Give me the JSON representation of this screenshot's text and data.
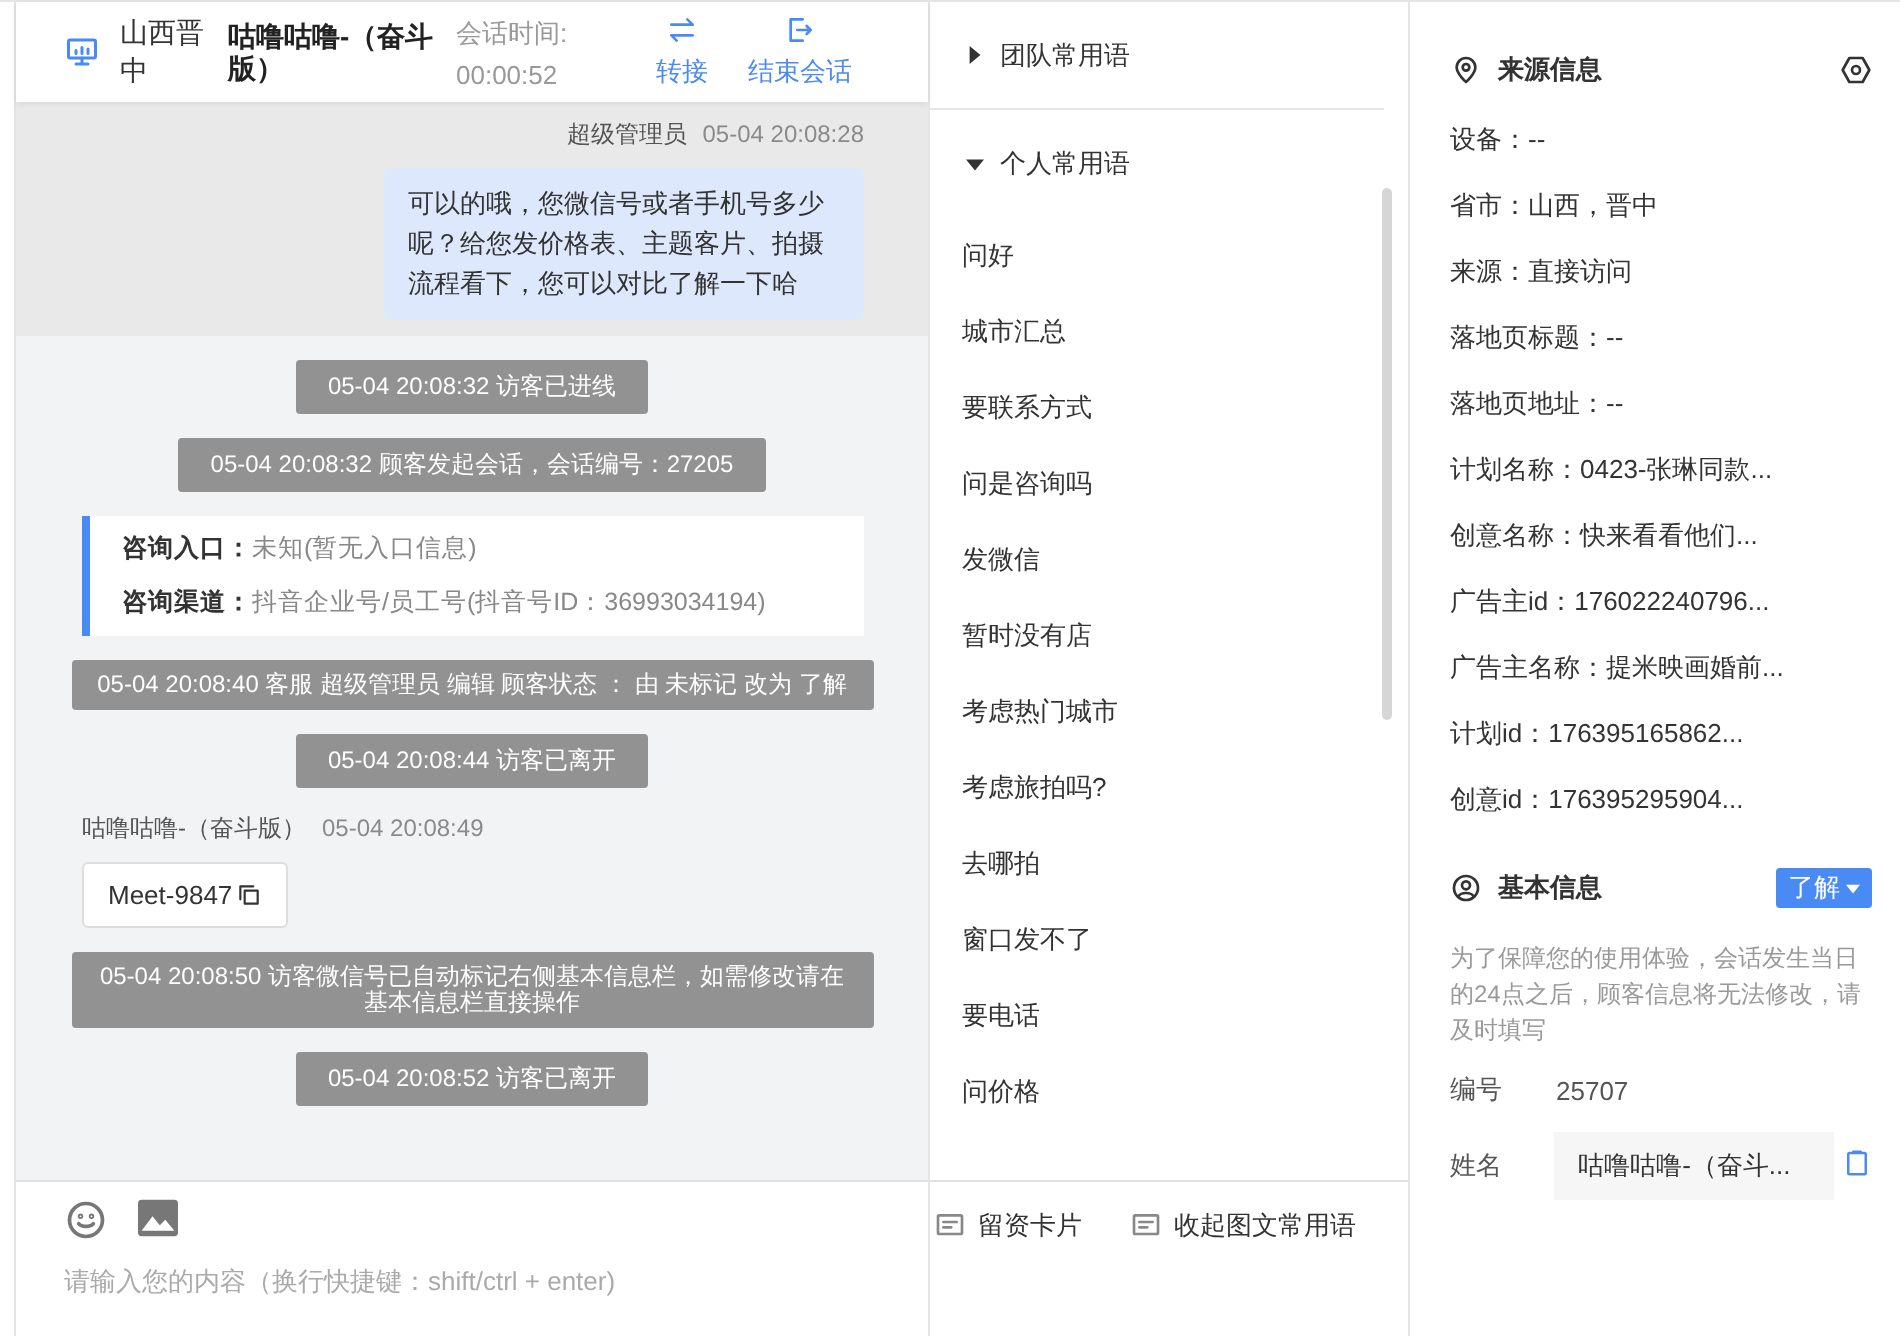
{
  "header": {
    "location": "山西晋中",
    "visitor": "咕噜咕噜-（奋斗版）",
    "timer_label": "会话时间:",
    "timer": "00:00:52",
    "actions": [
      {
        "kind": "transfer",
        "label": "转接"
      },
      {
        "kind": "end",
        "label": "结束会话"
      }
    ]
  },
  "messages": [
    {
      "kind": "agent",
      "sender": "超级管理员",
      "time": "05-04 20:08:28",
      "text": "可以的哦，您微信号或者手机号多少呢？给您发价格表、主题客片、拍摄流程看下，您可以对比了解一下哈",
      "highlighted": true
    },
    {
      "kind": "system",
      "text": "05-04 20:08:32 访客已进线",
      "wide": false
    },
    {
      "kind": "system",
      "text": "05-04 20:08:32 顾客发起会话，会话编号：27205",
      "wide": false
    },
    {
      "kind": "info",
      "lines": [
        {
          "label": "咨询入口：",
          "value": "未知(暂无入口信息)"
        },
        {
          "label": "咨询渠道：",
          "value": "抖音企业号/员工号(抖音号ID：36993034194)"
        }
      ]
    },
    {
      "kind": "system",
      "text": "05-04 20:08:40 客服 超级管理员 编辑 顾客状态 ： 由 未标记 改为 了解",
      "wide": true
    },
    {
      "kind": "system",
      "text": "05-04 20:08:44 访客已离开",
      "wide": false
    },
    {
      "kind": "visitor",
      "sender": "咕噜咕噜-（奋斗版）",
      "time": "05-04 20:08:49",
      "text": "Meet-9847"
    },
    {
      "kind": "system",
      "text": "05-04 20:08:50 访客微信号已自动标记右侧基本信息栏，如需修改请在基本信息栏直接操作",
      "wide": true
    },
    {
      "kind": "system",
      "text": "05-04 20:08:52 访客已离开",
      "wide": false
    }
  ],
  "composer": {
    "placeholder": "请输入您的内容（换行快捷键：shift/ctrl + enter)",
    "tools": [
      {
        "label": "留资卡片"
      },
      {
        "label": "收起图文常用语"
      }
    ]
  },
  "phrases": {
    "groups": [
      {
        "title": "团队常用语",
        "expanded": false
      },
      {
        "title": "个人常用语",
        "expanded": true,
        "items": [
          "问好",
          "城市汇总",
          "要联系方式",
          "问是咨询吗",
          "发微信",
          "暂时没有店",
          "考虑热门城市",
          "考虑旅拍吗?",
          "去哪拍",
          "窗口发不了",
          "要电话",
          "问价格"
        ]
      }
    ]
  },
  "source_info": {
    "title": "来源信息",
    "fields": [
      "设备：--",
      "省市：山西，晋中",
      "来源：直接访问",
      "落地页标题：--",
      "落地页地址：--",
      "计划名称：0423-张琳同款...",
      "创意名称：快来看看他们...",
      "广告主id：176022240796...",
      "广告主名称：提米映画婚前...",
      "计划id：176395165862...",
      "创意id：176395295904..."
    ]
  },
  "basic_info": {
    "title": "基本信息",
    "status": "了解",
    "notice": "为了保障您的使用体验，会话发生当日的24点之后，顾客信息将无法修改，请及时填写",
    "rows": [
      {
        "kind": "text",
        "label": "编号",
        "value": "25707"
      },
      {
        "kind": "field",
        "label": "姓名",
        "value": "咕噜咕噜-（奋斗..."
      }
    ]
  }
}
